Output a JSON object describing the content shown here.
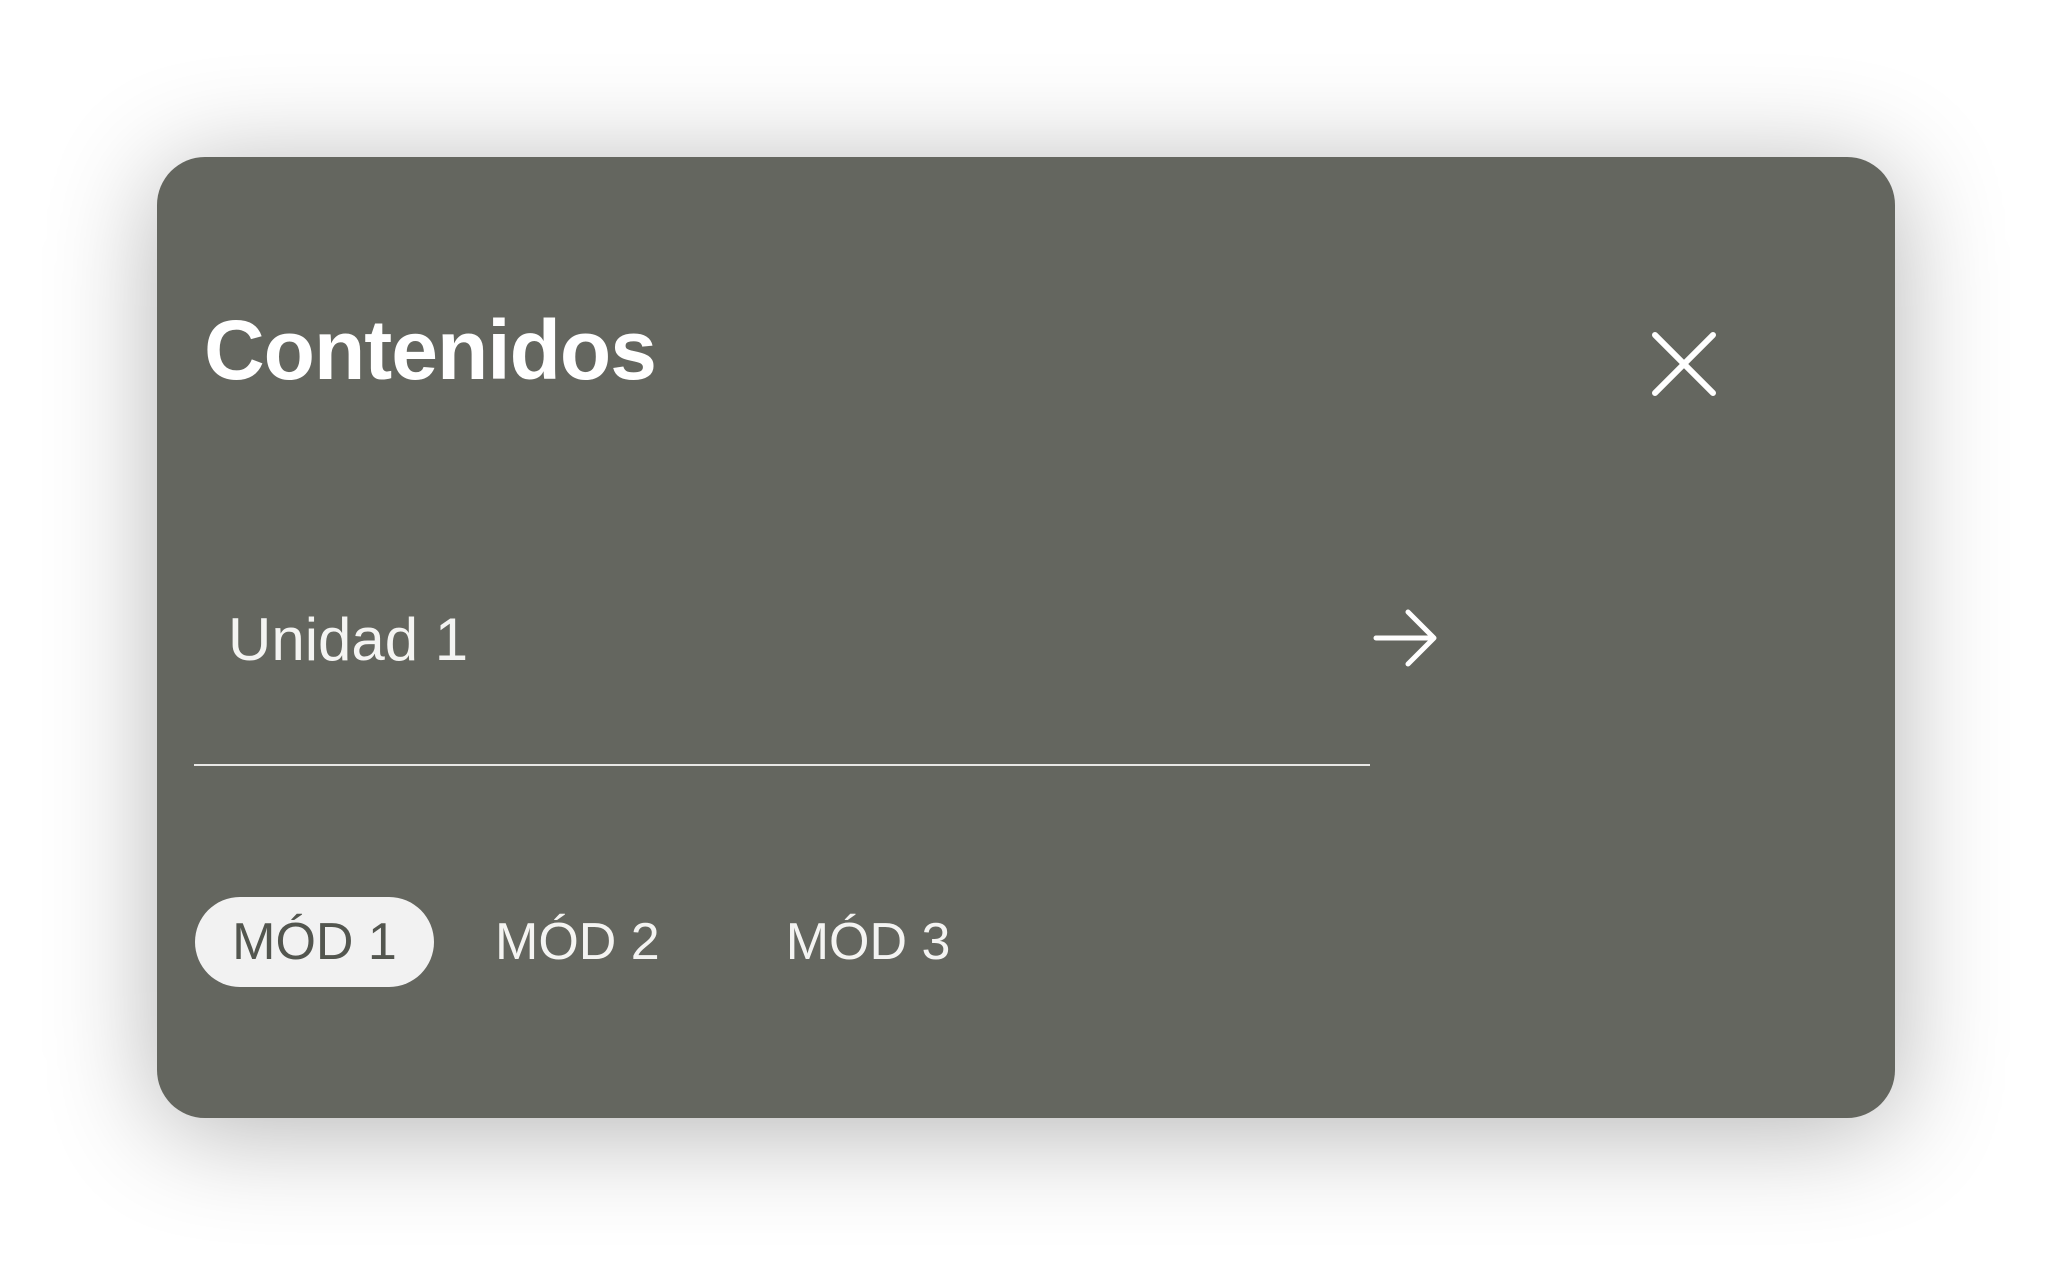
{
  "dialog": {
    "title": "Contenidos",
    "close_icon": "close-icon",
    "unit": {
      "label": "Unidad 1",
      "icon": "arrow-right-icon"
    },
    "tabs": [
      {
        "label": "MÓD 1",
        "active": true
      },
      {
        "label": "MÓD 2",
        "active": false
      },
      {
        "label": "MÓD 3",
        "active": false
      }
    ]
  },
  "colors": {
    "dialog_background": "#64665f",
    "text": "#ffffff",
    "active_tab_background": "#f2f2f2",
    "active_tab_text": "#53564f"
  }
}
